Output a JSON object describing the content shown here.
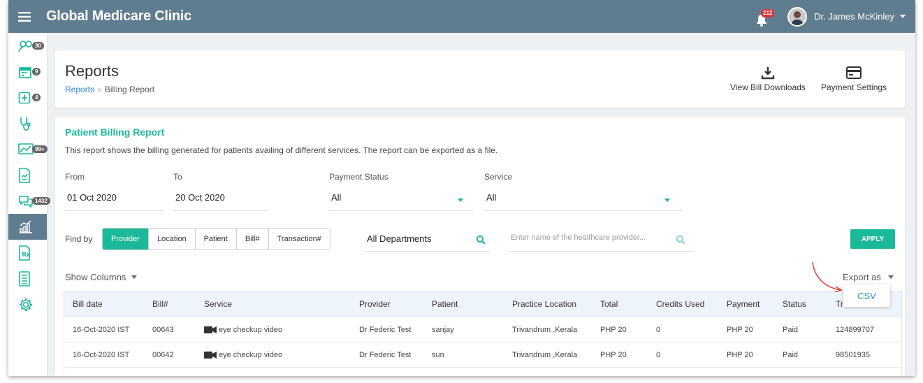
{
  "app": {
    "title": "Global Medicare Clinic",
    "notification_count": "212",
    "user_name": "Dr. James McKinley"
  },
  "sidebar": {
    "items": [
      {
        "name": "sidebar-item-patients",
        "badge": "30"
      },
      {
        "name": "sidebar-item-appointments",
        "badge": "9"
      },
      {
        "name": "sidebar-item-medical",
        "badge": "4"
      },
      {
        "name": "sidebar-item-consult",
        "badge": ""
      },
      {
        "name": "sidebar-item-monitor",
        "badge": "99+"
      },
      {
        "name": "sidebar-item-documents",
        "badge": ""
      },
      {
        "name": "sidebar-item-messages",
        "badge": "1432"
      },
      {
        "name": "sidebar-item-reports",
        "badge": ""
      },
      {
        "name": "sidebar-item-prescriptions",
        "badge": ""
      },
      {
        "name": "sidebar-item-billing",
        "badge": ""
      },
      {
        "name": "sidebar-item-settings",
        "badge": ""
      }
    ]
  },
  "header": {
    "title": "Reports",
    "breadcrumb_link": "Reports",
    "breadcrumb_sep": "»",
    "breadcrumb_current": "Billing Report",
    "view_downloads": "View Bill Downloads",
    "payment_settings": "Payment Settings"
  },
  "report": {
    "title": "Patient Billing Report",
    "description": "This report shows the billing generated for patients availing of different services. The report can be exported as a file."
  },
  "filters": {
    "from_label": "From",
    "from_value": "01 Oct 2020",
    "to_label": "To",
    "to_value": "20 Oct 2020",
    "payment_status_label": "Payment Status",
    "payment_status_value": "All",
    "service_label": "Service",
    "service_value": "All",
    "find_by_label": "Find by",
    "find_by_options": [
      "Provider",
      "Location",
      "Patient",
      "Bill#",
      "Transaction#"
    ],
    "find_by_selected": "Provider",
    "department_value": "All Departments",
    "provider_placeholder": "Enter name of the healthcare provider...",
    "apply_label": "APPLY"
  },
  "toolbar": {
    "show_columns": "Show Columns",
    "export_as": "Export as",
    "export_option": "CSV"
  },
  "table": {
    "columns": [
      "Bill date",
      "Bill#",
      "Service",
      "Provider",
      "Patient",
      "Practice Location",
      "Total",
      "Credits Used",
      "Payment",
      "Status",
      "Tr"
    ],
    "rows": [
      {
        "bill_date": "16-Oct-2020 IST",
        "bill_no": "00643",
        "service": "eye checkup video",
        "provider": "Dr Federic Test",
        "patient": "sanjay",
        "location": "Trivandrum ,Kerala",
        "total": "PHP 20",
        "credits": "0",
        "payment": "PHP 20",
        "status": "Paid",
        "transaction": "124899707"
      },
      {
        "bill_date": "16-Oct-2020 IST",
        "bill_no": "00642",
        "service": "eye checkup video",
        "provider": "Dr Federic Test",
        "patient": "sun",
        "location": "Trivandrum ,Kerala",
        "total": "PHP 20",
        "credits": "0",
        "payment": "PHP 20",
        "status": "Paid",
        "transaction": "98501935"
      }
    ]
  },
  "colors": {
    "topbar": "#5f7d8f",
    "accent": "#1bb99a",
    "link": "#2b8cd6",
    "paid": "#2a8a2a",
    "badge": "#e0312f"
  }
}
